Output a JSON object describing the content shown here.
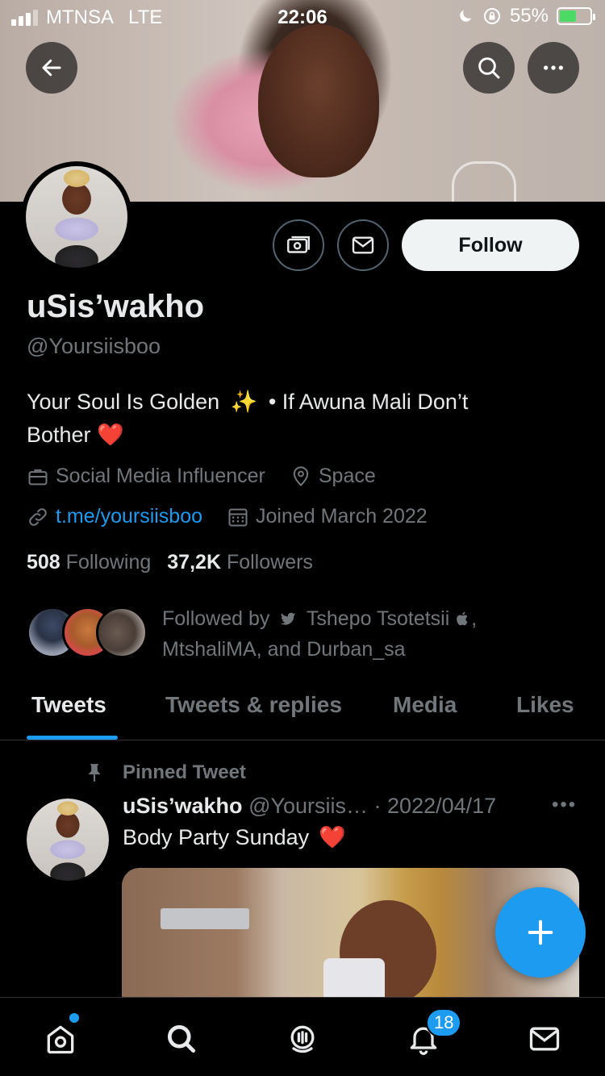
{
  "status_bar": {
    "carrier": "MTNSA",
    "network": "LTE",
    "time": "22:06",
    "battery": "55%"
  },
  "profile": {
    "display_name": "uSis’wakho",
    "handle": "@Yoursiisboo",
    "follow_label": "Follow",
    "bio_line1": "Your Soul Is Golden",
    "bio_sparkle": "✨",
    "bio_line1_rest": "• If Awuna Mali Don’t",
    "bio_line2": "Bother",
    "bio_heart": "❤️",
    "category": "Social Media Influencer",
    "location": "Space",
    "website": "t.me/yoursiisboo",
    "joined": "Joined March 2022",
    "following_count": "508",
    "following_label": "Following",
    "followers_count": "37,2K",
    "followers_label": "Followers",
    "followed_by_prefix": "Followed by",
    "followed_by_name1": "Tshepo Tsotetsii",
    "followed_by_rest_a": ",",
    "followed_by_rest_b": "MtshaliMA, and Durban_sa"
  },
  "tabs": [
    {
      "label": "Tweets",
      "active": true
    },
    {
      "label": "Tweets & replies",
      "active": false
    },
    {
      "label": "Media",
      "active": false
    },
    {
      "label": "Likes",
      "active": false
    }
  ],
  "pinned_tweet": {
    "pinned_label": "Pinned Tweet",
    "author_name": "uSis’wakho",
    "author_handle": "@Yoursiis…",
    "date": "· 2022/04/17",
    "more": "•••",
    "text": "Body Party Sunday",
    "emoji": "❤️"
  },
  "bottom_nav": {
    "notifications_badge": "18"
  },
  "colors": {
    "accent": "#1d9bf0",
    "background": "#000000",
    "secondary_text": "#71767b"
  }
}
